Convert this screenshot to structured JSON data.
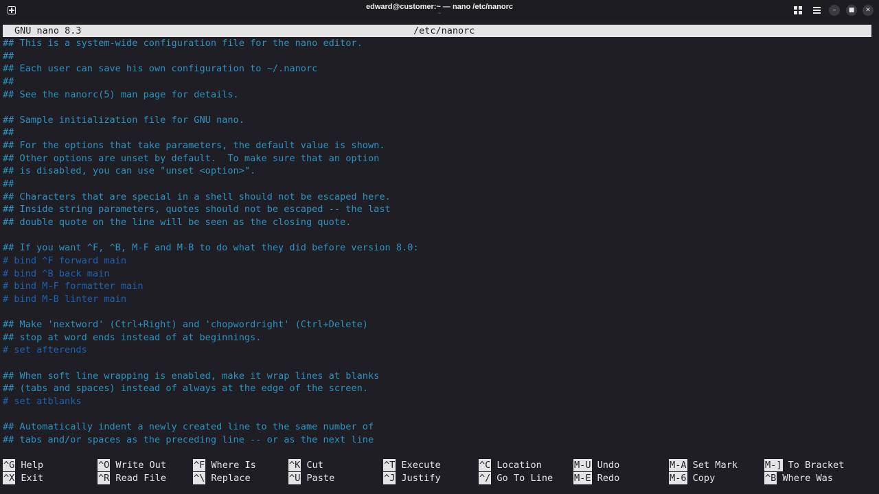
{
  "window": {
    "title": "edward@customer:~ — nano /etc/nanorc",
    "subtitle": "~"
  },
  "nano": {
    "version": "GNU nano 8.3",
    "filename": "/etc/nanorc"
  },
  "lines": [
    {
      "text": "## This is a system-wide configuration file for the nano editor.",
      "dim": false
    },
    {
      "text": "##",
      "dim": false
    },
    {
      "text": "## Each user can save his own configuration to ~/.nanorc",
      "dim": false
    },
    {
      "text": "##",
      "dim": false
    },
    {
      "text": "## See the nanorc(5) man page for details.",
      "dim": false
    },
    {
      "text": "",
      "dim": false
    },
    {
      "text": "## Sample initialization file for GNU nano.",
      "dim": false
    },
    {
      "text": "##",
      "dim": false
    },
    {
      "text": "## For the options that take parameters, the default value is shown.",
      "dim": false
    },
    {
      "text": "## Other options are unset by default.  To make sure that an option",
      "dim": false
    },
    {
      "text": "## is disabled, you can use \"unset <option>\".",
      "dim": false
    },
    {
      "text": "##",
      "dim": false
    },
    {
      "text": "## Characters that are special in a shell should not be escaped here.",
      "dim": false
    },
    {
      "text": "## Inside string parameters, quotes should not be escaped -- the last",
      "dim": false
    },
    {
      "text": "## double quote on the line will be seen as the closing quote.",
      "dim": false
    },
    {
      "text": "",
      "dim": false
    },
    {
      "text": "## If you want ^F, ^B, M-F and M-B to do what they did before version 8.0:",
      "dim": false
    },
    {
      "text": "# bind ^F forward main",
      "dim": true
    },
    {
      "text": "# bind ^B back main",
      "dim": true
    },
    {
      "text": "# bind M-F formatter main",
      "dim": true
    },
    {
      "text": "# bind M-B linter main",
      "dim": true
    },
    {
      "text": "",
      "dim": false
    },
    {
      "text": "## Make 'nextword' (Ctrl+Right) and 'chopwordright' (Ctrl+Delete)",
      "dim": false
    },
    {
      "text": "## stop at word ends instead of at beginnings.",
      "dim": false
    },
    {
      "text": "# set afterends",
      "dim": true
    },
    {
      "text": "",
      "dim": false
    },
    {
      "text": "## When soft line wrapping is enabled, make it wrap lines at blanks",
      "dim": false
    },
    {
      "text": "## (tabs and spaces) instead of always at the edge of the screen.",
      "dim": false
    },
    {
      "text": "# set atblanks",
      "dim": true
    },
    {
      "text": "",
      "dim": false
    },
    {
      "text": "## Automatically indent a newly created line to the same number of",
      "dim": false
    },
    {
      "text": "## tabs and/or spaces as the preceding line -- or as the next line",
      "dim": false
    }
  ],
  "shortcuts": [
    {
      "key": "^G",
      "label": "Help"
    },
    {
      "key": "^X",
      "label": "Exit"
    },
    {
      "key": "^O",
      "label": "Write Out"
    },
    {
      "key": "^R",
      "label": "Read File"
    },
    {
      "key": "^F",
      "label": "Where Is"
    },
    {
      "key": "^\\",
      "label": "Replace"
    },
    {
      "key": "^K",
      "label": "Cut"
    },
    {
      "key": "^U",
      "label": "Paste"
    },
    {
      "key": "^T",
      "label": "Execute"
    },
    {
      "key": "^J",
      "label": "Justify"
    },
    {
      "key": "^C",
      "label": "Location"
    },
    {
      "key": "^/",
      "label": "Go To Line"
    },
    {
      "key": "M-U",
      "label": "Undo"
    },
    {
      "key": "M-E",
      "label": "Redo"
    },
    {
      "key": "M-A",
      "label": "Set Mark"
    },
    {
      "key": "M-6",
      "label": "Copy"
    },
    {
      "key": "M-]",
      "label": "To Bracket"
    },
    {
      "key": "^B",
      "label": "Where Was"
    }
  ],
  "icons": {
    "new_tab": "new-tab-icon",
    "grid": "grid-view-icon",
    "menu": "hamburger-menu-icon",
    "minimize": "minimize-icon",
    "maximize": "maximize-icon",
    "close": "close-icon",
    "minimize_glyph": "–",
    "maximize_glyph": "■",
    "close_glyph": "✕"
  },
  "colors": {
    "comment": "#2e93c0",
    "commented_setting": "#1e62b0",
    "header_bg": "#e4e4e6",
    "background": "#1e1e24"
  }
}
